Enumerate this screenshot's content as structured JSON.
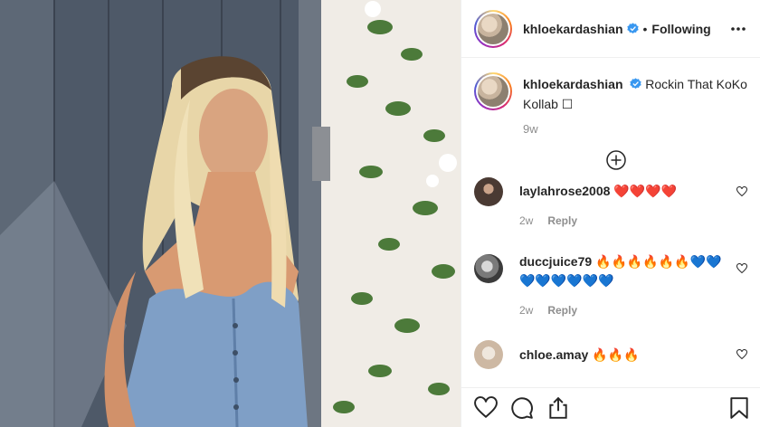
{
  "post": {
    "username": "khloekardashian",
    "following_label": "Following",
    "separator": "•",
    "caption_username": "khloekardashian",
    "caption_text": "Rockin That KoKo Kollab ☐",
    "caption_time": "9w"
  },
  "comments": [
    {
      "username": "laylahrose2008",
      "text": "❤️❤️❤️❤️",
      "time": "2w",
      "reply_label": "Reply"
    },
    {
      "username": "duccjuice79",
      "text": "🔥🔥🔥🔥🔥🔥💙💙💙💙💙💙💙💙",
      "time": "2w",
      "reply_label": "Reply"
    },
    {
      "username": "chloe.amay",
      "text": "🔥🔥🔥"
    }
  ],
  "icons": {
    "verified": "verified-badge-icon",
    "more": "more-options-icon",
    "load_more": "plus-circle-icon",
    "like": "heart-icon",
    "comment": "comment-icon",
    "share": "share-icon",
    "save": "bookmark-icon"
  },
  "colors": {
    "verified_blue": "#3897f0",
    "text": "#262626",
    "secondary": "#8e8e8e",
    "border": "#efefef"
  }
}
